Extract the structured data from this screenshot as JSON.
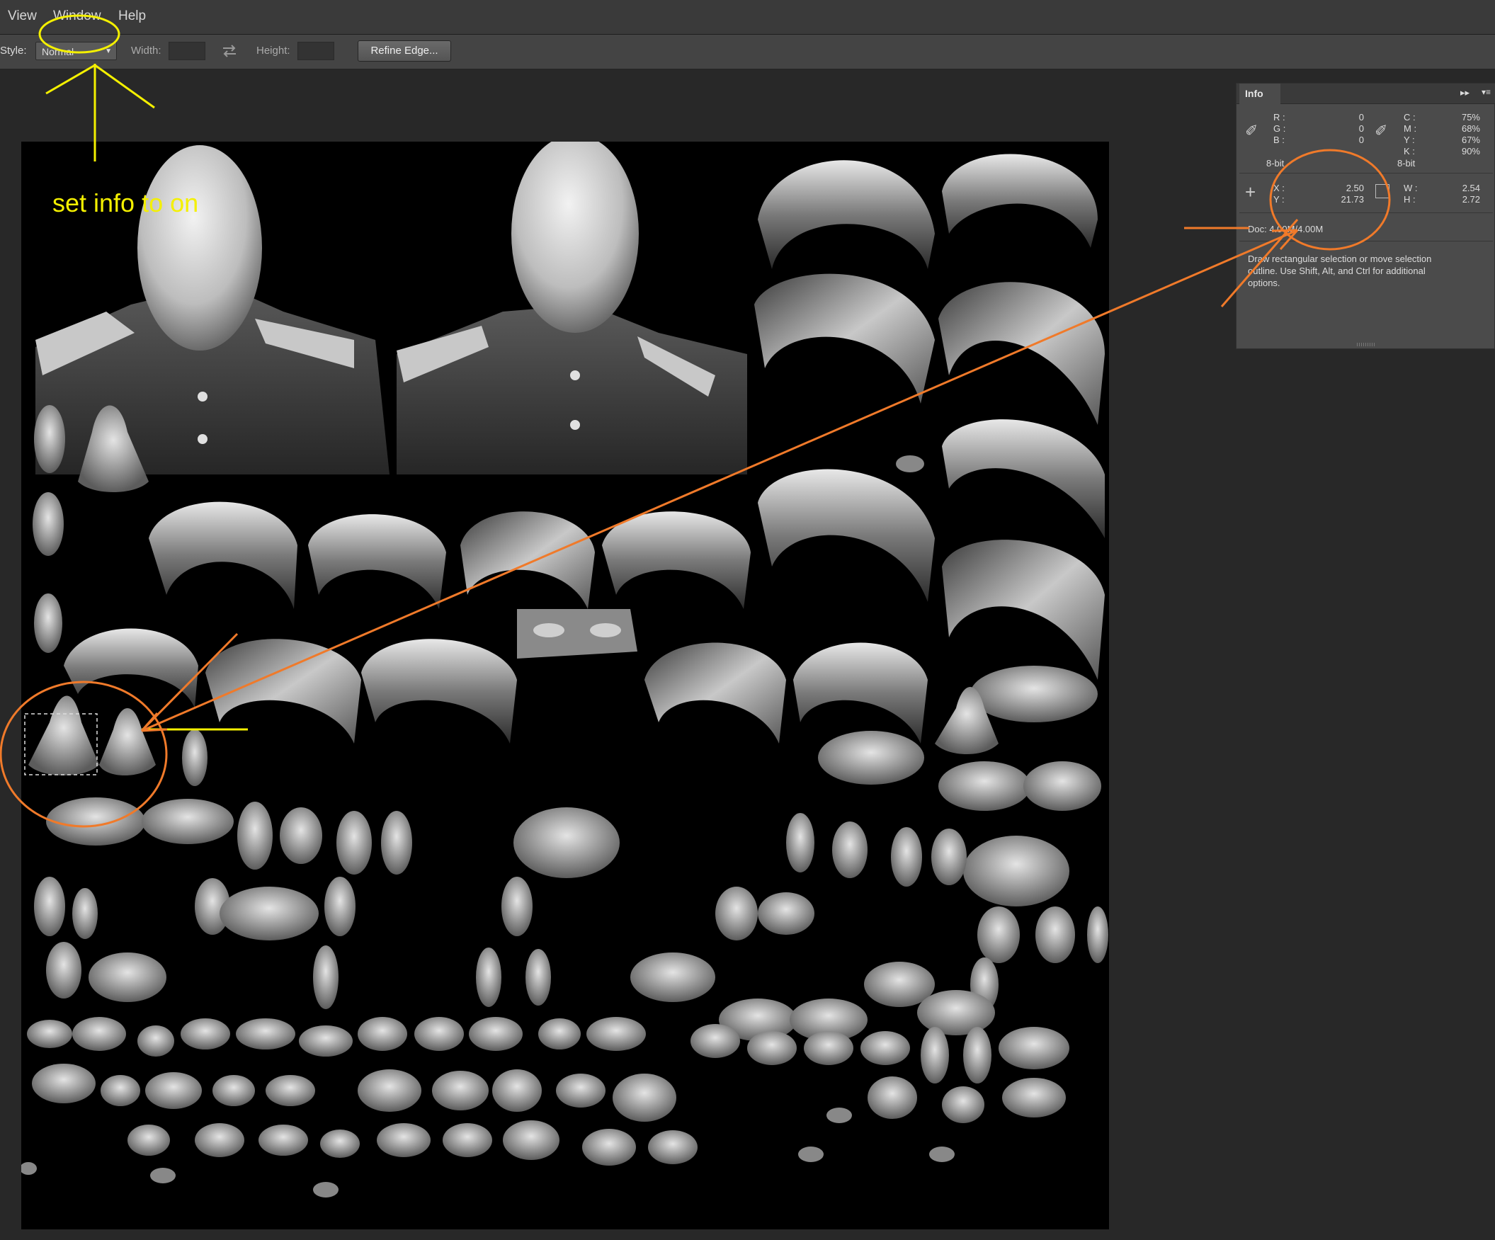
{
  "menubar": {
    "view": "View",
    "window": "Window",
    "help": "Help"
  },
  "options": {
    "style_label": "Style:",
    "style_value": "Normal",
    "width_label": "Width:",
    "height_label": "Height:",
    "refine_label": "Refine Edge..."
  },
  "info": {
    "tab": "Info",
    "r_label": "R :",
    "g_label": "G :",
    "b_label": "B :",
    "r": "0",
    "g": "0",
    "b": "0",
    "c_label": "C :",
    "m_label": "M :",
    "y_label": "Y :",
    "k_label": "K :",
    "c": "75%",
    "m": "68%",
    "y": "67%",
    "k": "90%",
    "bit_left": "8-bit",
    "bit_right": "8-bit",
    "x_label": "X :",
    "y2_label": "Y :",
    "x": "2.50",
    "y2": "21.73",
    "w_label": "W :",
    "h_label": "H :",
    "w": "2.54",
    "h": "2.72",
    "doc": "Doc: 4.00M/4.00M",
    "hint": [
      "Draw rectangular selection or move selection",
      "outline.  Use Shift, Alt, and Ctrl for additional",
      "options."
    ]
  },
  "annotation": {
    "note": "set info to on"
  },
  "colors": {
    "annotation_yellow": "#f4f000",
    "annotation_orange": "#f07a2a"
  }
}
